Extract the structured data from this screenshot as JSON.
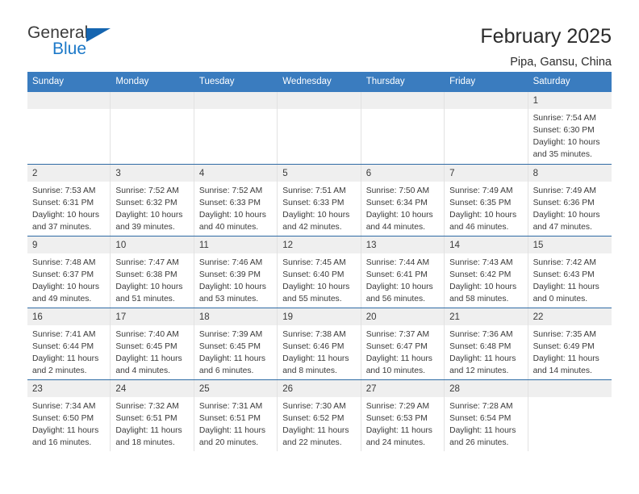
{
  "logo": {
    "word_top": "General",
    "word_bottom": "Blue",
    "triangle_color": "#1565b0",
    "blue_color": "#1b78c8"
  },
  "header": {
    "title": "February 2025",
    "subtitle": "Pipa, Gansu, China"
  },
  "theme": {
    "header_blue": "#3a7cbf",
    "row_divider": "#2f6ba5",
    "daynum_band": "#efefef",
    "text": "#3a3a3a"
  },
  "weekdays": [
    "Sunday",
    "Monday",
    "Tuesday",
    "Wednesday",
    "Thursday",
    "Friday",
    "Saturday"
  ],
  "labels": {
    "sunrise": "Sunrise:",
    "sunset": "Sunset:",
    "daylight": "Daylight:"
  },
  "weeks": [
    [
      {
        "day": "",
        "empty": true
      },
      {
        "day": "",
        "empty": true
      },
      {
        "day": "",
        "empty": true
      },
      {
        "day": "",
        "empty": true
      },
      {
        "day": "",
        "empty": true
      },
      {
        "day": "",
        "empty": true
      },
      {
        "day": "1",
        "sunrise": "Sunrise: 7:54 AM",
        "sunset": "Sunset: 6:30 PM",
        "daylight": "Daylight: 10 hours and 35 minutes."
      }
    ],
    [
      {
        "day": "2",
        "sunrise": "Sunrise: 7:53 AM",
        "sunset": "Sunset: 6:31 PM",
        "daylight": "Daylight: 10 hours and 37 minutes."
      },
      {
        "day": "3",
        "sunrise": "Sunrise: 7:52 AM",
        "sunset": "Sunset: 6:32 PM",
        "daylight": "Daylight: 10 hours and 39 minutes."
      },
      {
        "day": "4",
        "sunrise": "Sunrise: 7:52 AM",
        "sunset": "Sunset: 6:33 PM",
        "daylight": "Daylight: 10 hours and 40 minutes."
      },
      {
        "day": "5",
        "sunrise": "Sunrise: 7:51 AM",
        "sunset": "Sunset: 6:33 PM",
        "daylight": "Daylight: 10 hours and 42 minutes."
      },
      {
        "day": "6",
        "sunrise": "Sunrise: 7:50 AM",
        "sunset": "Sunset: 6:34 PM",
        "daylight": "Daylight: 10 hours and 44 minutes."
      },
      {
        "day": "7",
        "sunrise": "Sunrise: 7:49 AM",
        "sunset": "Sunset: 6:35 PM",
        "daylight": "Daylight: 10 hours and 46 minutes."
      },
      {
        "day": "8",
        "sunrise": "Sunrise: 7:49 AM",
        "sunset": "Sunset: 6:36 PM",
        "daylight": "Daylight: 10 hours and 47 minutes."
      }
    ],
    [
      {
        "day": "9",
        "sunrise": "Sunrise: 7:48 AM",
        "sunset": "Sunset: 6:37 PM",
        "daylight": "Daylight: 10 hours and 49 minutes."
      },
      {
        "day": "10",
        "sunrise": "Sunrise: 7:47 AM",
        "sunset": "Sunset: 6:38 PM",
        "daylight": "Daylight: 10 hours and 51 minutes."
      },
      {
        "day": "11",
        "sunrise": "Sunrise: 7:46 AM",
        "sunset": "Sunset: 6:39 PM",
        "daylight": "Daylight: 10 hours and 53 minutes."
      },
      {
        "day": "12",
        "sunrise": "Sunrise: 7:45 AM",
        "sunset": "Sunset: 6:40 PM",
        "daylight": "Daylight: 10 hours and 55 minutes."
      },
      {
        "day": "13",
        "sunrise": "Sunrise: 7:44 AM",
        "sunset": "Sunset: 6:41 PM",
        "daylight": "Daylight: 10 hours and 56 minutes."
      },
      {
        "day": "14",
        "sunrise": "Sunrise: 7:43 AM",
        "sunset": "Sunset: 6:42 PM",
        "daylight": "Daylight: 10 hours and 58 minutes."
      },
      {
        "day": "15",
        "sunrise": "Sunrise: 7:42 AM",
        "sunset": "Sunset: 6:43 PM",
        "daylight": "Daylight: 11 hours and 0 minutes."
      }
    ],
    [
      {
        "day": "16",
        "sunrise": "Sunrise: 7:41 AM",
        "sunset": "Sunset: 6:44 PM",
        "daylight": "Daylight: 11 hours and 2 minutes."
      },
      {
        "day": "17",
        "sunrise": "Sunrise: 7:40 AM",
        "sunset": "Sunset: 6:45 PM",
        "daylight": "Daylight: 11 hours and 4 minutes."
      },
      {
        "day": "18",
        "sunrise": "Sunrise: 7:39 AM",
        "sunset": "Sunset: 6:45 PM",
        "daylight": "Daylight: 11 hours and 6 minutes."
      },
      {
        "day": "19",
        "sunrise": "Sunrise: 7:38 AM",
        "sunset": "Sunset: 6:46 PM",
        "daylight": "Daylight: 11 hours and 8 minutes."
      },
      {
        "day": "20",
        "sunrise": "Sunrise: 7:37 AM",
        "sunset": "Sunset: 6:47 PM",
        "daylight": "Daylight: 11 hours and 10 minutes."
      },
      {
        "day": "21",
        "sunrise": "Sunrise: 7:36 AM",
        "sunset": "Sunset: 6:48 PM",
        "daylight": "Daylight: 11 hours and 12 minutes."
      },
      {
        "day": "22",
        "sunrise": "Sunrise: 7:35 AM",
        "sunset": "Sunset: 6:49 PM",
        "daylight": "Daylight: 11 hours and 14 minutes."
      }
    ],
    [
      {
        "day": "23",
        "sunrise": "Sunrise: 7:34 AM",
        "sunset": "Sunset: 6:50 PM",
        "daylight": "Daylight: 11 hours and 16 minutes."
      },
      {
        "day": "24",
        "sunrise": "Sunrise: 7:32 AM",
        "sunset": "Sunset: 6:51 PM",
        "daylight": "Daylight: 11 hours and 18 minutes."
      },
      {
        "day": "25",
        "sunrise": "Sunrise: 7:31 AM",
        "sunset": "Sunset: 6:51 PM",
        "daylight": "Daylight: 11 hours and 20 minutes."
      },
      {
        "day": "26",
        "sunrise": "Sunrise: 7:30 AM",
        "sunset": "Sunset: 6:52 PM",
        "daylight": "Daylight: 11 hours and 22 minutes."
      },
      {
        "day": "27",
        "sunrise": "Sunrise: 7:29 AM",
        "sunset": "Sunset: 6:53 PM",
        "daylight": "Daylight: 11 hours and 24 minutes."
      },
      {
        "day": "28",
        "sunrise": "Sunrise: 7:28 AM",
        "sunset": "Sunset: 6:54 PM",
        "daylight": "Daylight: 11 hours and 26 minutes."
      },
      {
        "day": "",
        "empty": true
      }
    ]
  ]
}
